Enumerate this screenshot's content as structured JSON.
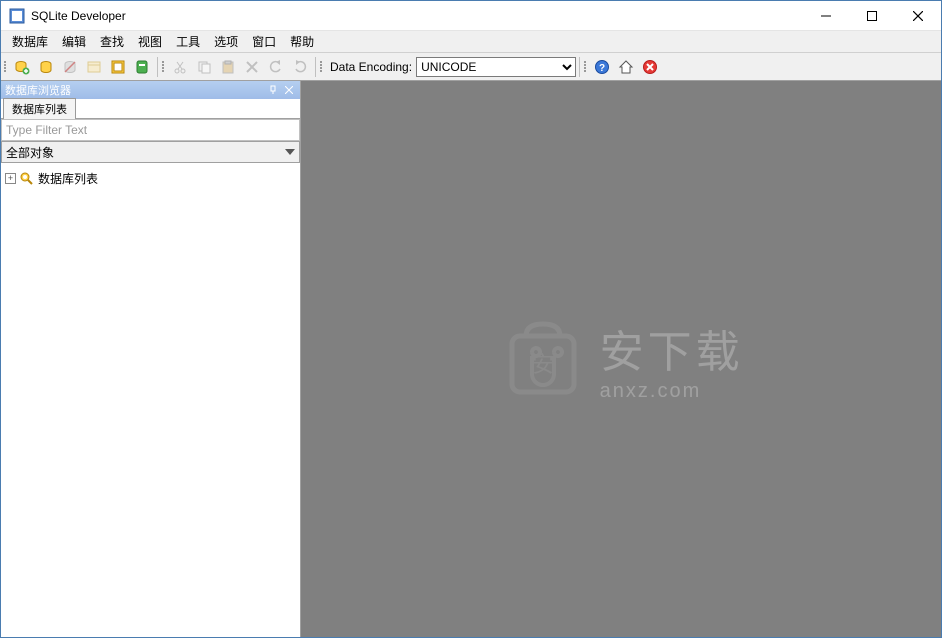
{
  "window": {
    "title": "SQLite Developer"
  },
  "menu": {
    "items": [
      "数据库",
      "编辑",
      "查找",
      "视图",
      "工具",
      "选项",
      "窗口",
      "帮助"
    ]
  },
  "toolbar": {
    "encoding_label": "Data Encoding:",
    "encoding_value": "UNICODE"
  },
  "sidebar": {
    "panel_title": "数据库浏览器",
    "tab_label": "数据库列表",
    "filter_placeholder": "Type Filter Text",
    "object_filter": "全部对象",
    "tree_root": "数据库列表"
  },
  "watermark": {
    "line1": "安下载",
    "line2": "anxz.com"
  }
}
